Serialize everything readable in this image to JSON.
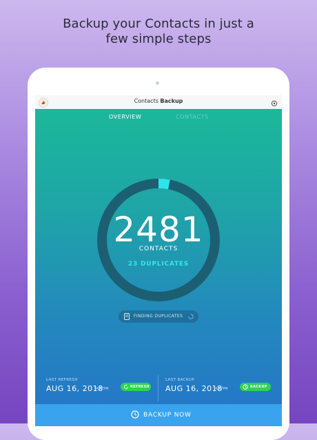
{
  "headline": {
    "line1": "Backup your Contacts in just a",
    "line2": "few simple steps"
  },
  "app": {
    "title_light": "Contacts ",
    "title_bold": "Backup"
  },
  "tabs": [
    {
      "label": "OVERVIEW",
      "active": true
    },
    {
      "label": "CONTACTS",
      "active": false
    }
  ],
  "summary": {
    "count": "2481",
    "count_label": "CONTACTS",
    "duplicates_label": "23 DUPLICATES",
    "progress_fraction": 0.03
  },
  "finding": {
    "label": "FINDING DUPLICATES"
  },
  "last_refresh": {
    "caption": "LAST REFRESH",
    "date": "AUG 16, 2018",
    "time": "4:27PM",
    "button": "REFRESH"
  },
  "last_backup": {
    "caption": "LAST BACKUP",
    "date": "AUG 16, 2018",
    "time": "4:27PM",
    "button": "BACKUP"
  },
  "backup_now": {
    "label": "BACKUP NOW"
  },
  "colors": {
    "accent_green": "#2ed34f",
    "duplicates_cyan": "#37e6ee",
    "backup_bar": "#3aa3ef",
    "ring_track": "#1c5f73",
    "ring_progress": "#2fe3ec"
  },
  "icons": [
    "app-logo-icon",
    "settings-icon",
    "document-icon",
    "spinner-icon",
    "refresh-icon",
    "clock-icon",
    "backup-clock-icon"
  ]
}
